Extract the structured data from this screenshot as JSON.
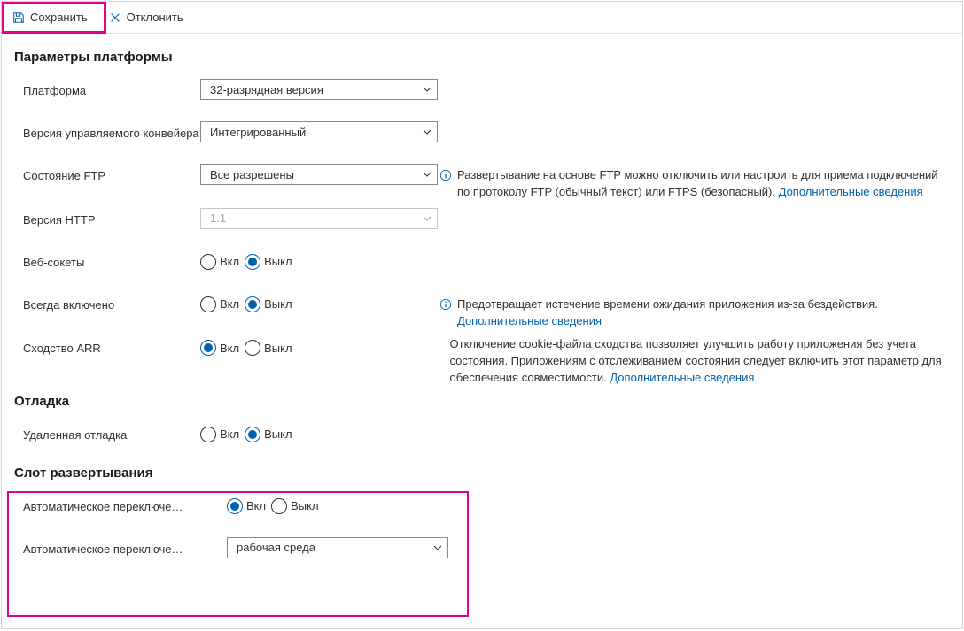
{
  "toolbar": {
    "save_label": "Сохранить",
    "discard_label": "Отклонить"
  },
  "sections": {
    "platform": "Параметры платформы",
    "debugging": "Отладка",
    "deployment_slot": "Слот развертывания"
  },
  "rows": {
    "platform": {
      "label": "Платформа",
      "value": "32-разрядная версия"
    },
    "pipeline": {
      "label": "Версия управляемого конвейера",
      "value": "Интегрированный"
    },
    "ftp_state": {
      "label": "Состояние FTP",
      "value": "Все разрешены",
      "info": "Развертывание на основе FTP можно отключить или настроить для приема подключений по протоколу FTP (обычный текст) или FTPS (безопасный).",
      "link": "Дополнительные сведения"
    },
    "http_version": {
      "label": "Версия HTTP",
      "value": "1.1"
    },
    "web_sockets": {
      "label": "Веб-сокеты",
      "on": "Вкл",
      "off": "Выкл",
      "selected": "off"
    },
    "always_on": {
      "label": "Всегда включено",
      "on": "Вкл",
      "off": "Выкл",
      "selected": "off",
      "info": "Предотвращает истечение времени ожидания приложения из-за бездействия.",
      "link": "Дополнительные сведения"
    },
    "arr_affinity": {
      "label": "Сходство ARR",
      "on": "Вкл",
      "off": "Выкл",
      "selected": "on",
      "info": "Отключение cookie-файла сходства позволяет улучшить работу приложения без учета состояния. Приложениям с отслеживанием состояния следует включить этот параметр для обеспечения совместимости.",
      "link": "Дополнительные сведения"
    },
    "remote_debug": {
      "label": "Удаленная отладка",
      "on": "Вкл",
      "off": "Выкл",
      "selected": "off"
    },
    "auto_swap_enabled": {
      "label": "Автоматическое переключе…",
      "on": "Вкл",
      "off": "Выкл",
      "selected": "on"
    },
    "auto_swap_slot": {
      "label": "Автоматическое переключе…",
      "value": "рабочая среда"
    }
  }
}
